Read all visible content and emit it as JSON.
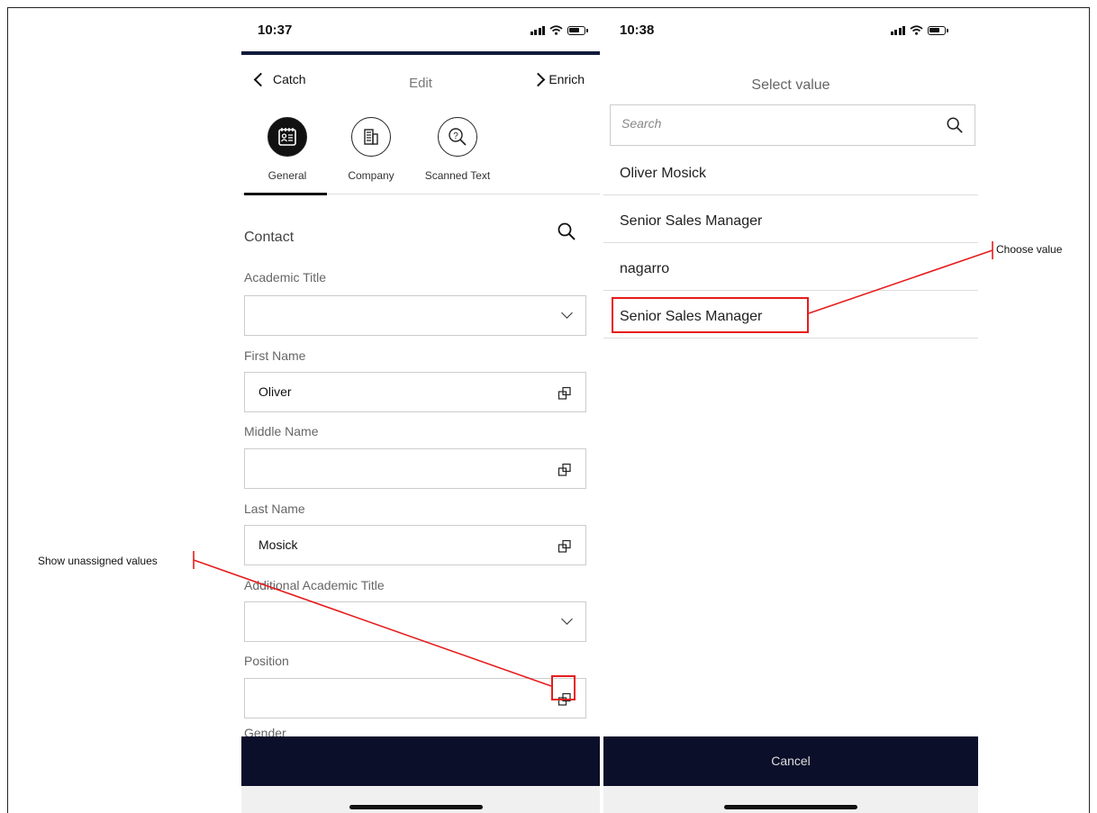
{
  "colors": {
    "accent": "#101a3a",
    "bottom_bar": "#0c0f2a",
    "annotation": "#e51c1c"
  },
  "left_screen": {
    "status_time": "10:37",
    "nav": {
      "back_label": "Catch",
      "title": "Edit",
      "next_label": "Enrich"
    },
    "tabs": [
      {
        "label": "General",
        "icon": "contact-card-icon",
        "active": true
      },
      {
        "label": "Company",
        "icon": "building-icon",
        "active": false
      },
      {
        "label": "Scanned Text",
        "icon": "magnifier-question-icon",
        "active": false
      }
    ],
    "section": {
      "title": "Contact",
      "search_icon": "search-icon"
    },
    "fields": [
      {
        "label": "Academic Title",
        "value": "",
        "control": "dropdown"
      },
      {
        "label": "First Name",
        "value": "Oliver",
        "control": "unassigned-values"
      },
      {
        "label": "Middle Name",
        "value": "",
        "control": "unassigned-values"
      },
      {
        "label": "Last Name",
        "value": "Mosick",
        "control": "unassigned-values"
      },
      {
        "label": "Additional Academic Title",
        "value": "",
        "control": "dropdown"
      },
      {
        "label": "Position",
        "value": "",
        "control": "unassigned-values"
      },
      {
        "label": "Gender"
      }
    ]
  },
  "right_screen": {
    "status_time": "10:38",
    "title": "Select value",
    "search": {
      "placeholder": "Search",
      "icon": "search-icon"
    },
    "items": [
      {
        "label": "Oliver Mosick"
      },
      {
        "label": "Senior Sales Manager"
      },
      {
        "label": "nagarro"
      },
      {
        "label": "Senior Sales Manager",
        "highlighted": true
      }
    ],
    "cancel_label": "Cancel"
  },
  "annotations": {
    "show_unassigned": "Show unassigned values",
    "choose_value": "Choose value"
  }
}
